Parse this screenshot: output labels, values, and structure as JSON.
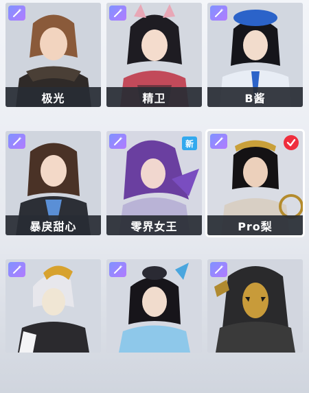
{
  "skins": [
    {
      "name": "极光",
      "badge": "",
      "selected": false
    },
    {
      "name": "精卫",
      "badge": "",
      "selected": false
    },
    {
      "name": "B酱",
      "badge": "",
      "selected": false
    },
    {
      "name": "暴戾甜心",
      "badge": "",
      "selected": false
    },
    {
      "name": "零界女王",
      "badge": "新",
      "selected": false
    },
    {
      "name": "Pro梨",
      "badge": "",
      "selected": true
    },
    {
      "name": "",
      "badge": "",
      "selected": false
    },
    {
      "name": "",
      "badge": "",
      "selected": false
    },
    {
      "name": "",
      "badge": "",
      "selected": false
    }
  ],
  "icons": {
    "corner_tag": "magic-wand-icon",
    "selected_tag": "check-icon"
  },
  "colors": {
    "wand_gradient_start": "#7f93ff",
    "wand_gradient_end": "#b27bff",
    "new_badge": "#33a9ee",
    "selected_badge": "#ef2e3d",
    "name_bar": "#282c34"
  }
}
